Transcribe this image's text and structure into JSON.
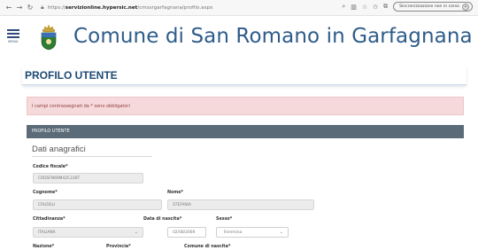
{
  "browser": {
    "back_icon": "back-arrow-icon",
    "forward_icon": "forward-arrow-icon",
    "reload_icon": "reload-icon",
    "url_prefix": "https://",
    "url_domain": "servizionline.hypersic.net",
    "url_path": "/cmssrgarfagnana/profilo.aspx",
    "sync_label": "Sincronizzazione non in corso"
  },
  "header": {
    "menu_label": "MENU",
    "site_title": "Comune di San Romano in Garfagnana"
  },
  "page": {
    "title": "PROFILO UTENTE",
    "required_notice": "I campi contrassegnati da * sono obbligatori",
    "section_title": "PROFILO UTENTE",
    "group_title": "Dati anagrafici"
  },
  "form": {
    "codice_fiscale_label": "Codice fiscale*",
    "codice_fiscale_value": "CRDSFN69M42C236T",
    "cognome_label": "Cognome*",
    "cognome_value": "CRUDELI",
    "nome_label": "Nome*",
    "nome_value": "STEFANIA",
    "cittadinanza_label": "Cittadinanza*",
    "cittadinanza_value": "ITALIANA",
    "data_nascita_label": "Data di nascita*",
    "data_nascita_value": "02/08/2069",
    "sesso_label": "Sesso*",
    "sesso_value": "Femmina",
    "nazione_label": "Nazione*",
    "provincia_label": "Provincia*",
    "comune_nascita_label": "Comune di nascita*"
  },
  "colors": {
    "title_blue": "#2e5c8a",
    "section_bar": "#5c6b78",
    "alert_bg": "#f6dadb"
  }
}
